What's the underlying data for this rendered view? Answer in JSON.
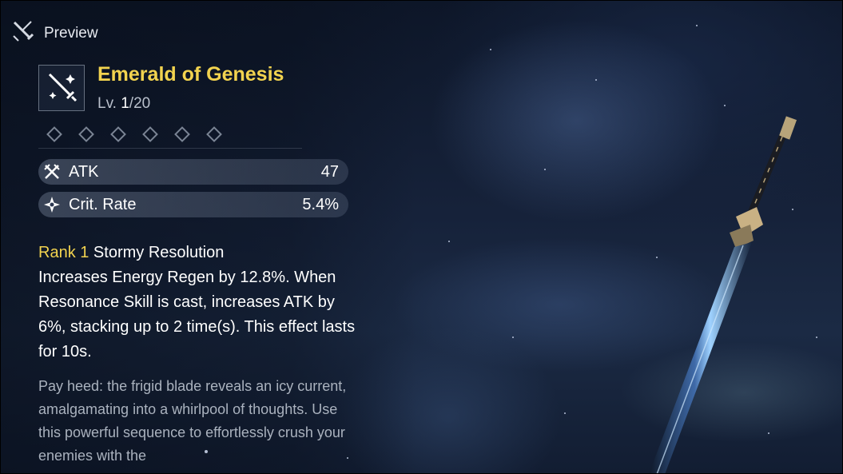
{
  "header": {
    "icon": "crossed-swords-icon",
    "label": "Preview"
  },
  "weapon": {
    "icon": "sword-icon",
    "name": "Emerald of Genesis",
    "level_prefix": "Lv. ",
    "level_current": "1",
    "level_max": "/20",
    "rank_slots": 6
  },
  "stats": [
    {
      "icon": "atk-icon",
      "label": "ATK",
      "value": "47"
    },
    {
      "icon": "crit-rate-icon",
      "label": "Crit. Rate",
      "value": "5.4%"
    }
  ],
  "effect": {
    "rank_label": "Rank 1",
    "title": " Stormy Resolution",
    "description": "Increases Energy Regen by 12.8%. When Resonance Skill is cast, increases ATK by 6%, stacking up to 2 time(s). This effect lasts for 10s."
  },
  "lore": "Pay heed: the frigid blade reveals an icy current, amalgamating into a whirlpool of thoughts. Use this powerful sequence to effortlessly crush your enemies with the",
  "colors": {
    "name_gold": "#f2d34f",
    "text_white": "#ffffff",
    "lore_gray": "#aab2be",
    "sky": "#16223a"
  }
}
